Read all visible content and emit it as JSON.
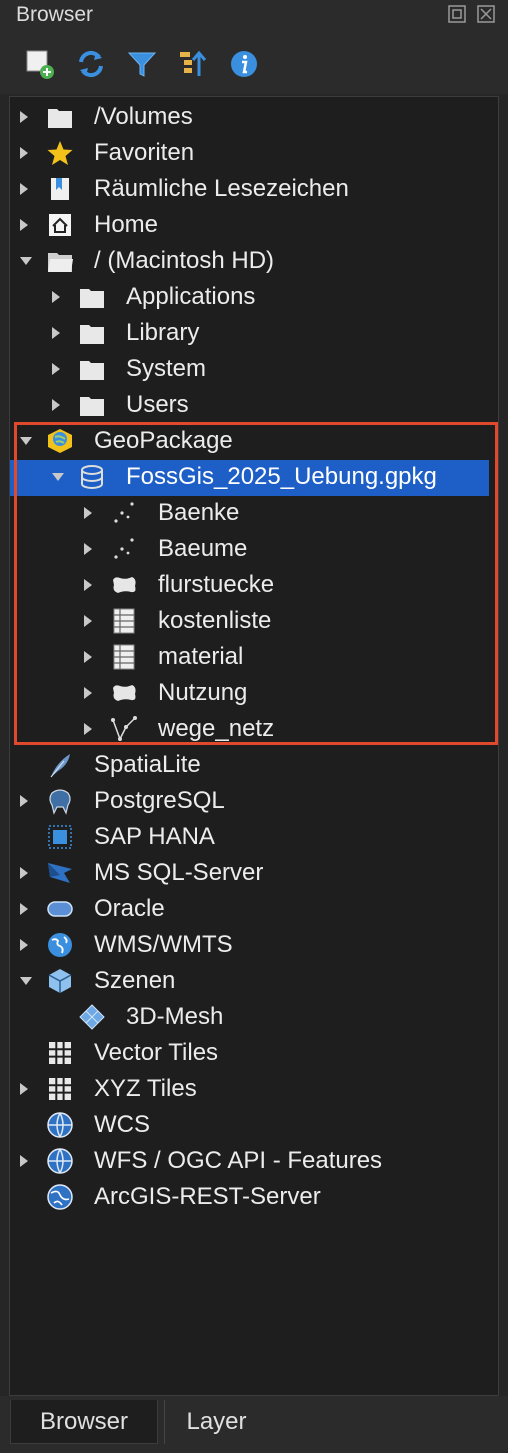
{
  "panel": {
    "title": "Browser"
  },
  "toolbar": {
    "buttons": [
      {
        "icon": "add-layer-icon"
      },
      {
        "icon": "refresh-icon"
      },
      {
        "icon": "filter-icon"
      },
      {
        "icon": "collapse-all-icon"
      },
      {
        "icon": "info-icon"
      }
    ]
  },
  "tree": {
    "items": [
      {
        "label": "/Volumes",
        "level": 0,
        "expander": "collapsed",
        "icon": "folder-icon"
      },
      {
        "label": "Favoriten",
        "level": 0,
        "expander": "collapsed",
        "icon": "star-icon"
      },
      {
        "label": "Räumliche Lesezeichen",
        "level": 0,
        "expander": "collapsed",
        "icon": "bookmark-icon"
      },
      {
        "label": "Home",
        "level": 0,
        "expander": "collapsed",
        "icon": "home-icon"
      },
      {
        "label": "/ (Macintosh HD)",
        "level": 0,
        "expander": "expanded",
        "icon": "folder-open-icon"
      },
      {
        "label": "Applications",
        "level": 1,
        "expander": "collapsed",
        "icon": "folder-icon"
      },
      {
        "label": "Library",
        "level": 1,
        "expander": "collapsed",
        "icon": "folder-icon"
      },
      {
        "label": "System",
        "level": 1,
        "expander": "collapsed",
        "icon": "folder-icon"
      },
      {
        "label": "Users",
        "level": 1,
        "expander": "collapsed",
        "icon": "folder-icon"
      },
      {
        "label": "GeoPackage",
        "level": 0,
        "expander": "expanded",
        "icon": "geopackage-icon"
      },
      {
        "label": "FossGis_2025_Uebung.gpkg",
        "level": 1,
        "expander": "expanded",
        "icon": "database-icon",
        "selected": true
      },
      {
        "label": "Baenke",
        "level": 2,
        "expander": "collapsed",
        "icon": "point-layer-icon"
      },
      {
        "label": "Baeume",
        "level": 2,
        "expander": "collapsed",
        "icon": "point-layer-icon"
      },
      {
        "label": "flurstuecke",
        "level": 2,
        "expander": "collapsed",
        "icon": "polygon-layer-icon"
      },
      {
        "label": "kostenliste",
        "level": 2,
        "expander": "collapsed",
        "icon": "table-icon"
      },
      {
        "label": "material",
        "level": 2,
        "expander": "collapsed",
        "icon": "table-icon"
      },
      {
        "label": "Nutzung",
        "level": 2,
        "expander": "collapsed",
        "icon": "polygon-layer-icon"
      },
      {
        "label": "wege_netz",
        "level": 2,
        "expander": "collapsed",
        "icon": "line-layer-icon"
      },
      {
        "label": "SpatiaLite",
        "level": 0,
        "expander": "none",
        "icon": "feather-icon"
      },
      {
        "label": "PostgreSQL",
        "level": 0,
        "expander": "collapsed",
        "icon": "elephant-icon"
      },
      {
        "label": "SAP HANA",
        "level": 0,
        "expander": "none",
        "icon": "hana-icon"
      },
      {
        "label": "MS SQL-Server",
        "level": 0,
        "expander": "collapsed",
        "icon": "mssql-icon"
      },
      {
        "label": "Oracle",
        "level": 0,
        "expander": "collapsed",
        "icon": "oracle-icon"
      },
      {
        "label": "WMS/WMTS",
        "level": 0,
        "expander": "collapsed",
        "icon": "globe-icon"
      },
      {
        "label": "Szenen",
        "level": 0,
        "expander": "expanded",
        "icon": "cube-icon"
      },
      {
        "label": "3D-Mesh",
        "level": 1,
        "expander": "none",
        "icon": "mesh-icon"
      },
      {
        "label": "Vector Tiles",
        "level": 0,
        "expander": "none",
        "icon": "grid-icon"
      },
      {
        "label": "XYZ Tiles",
        "level": 0,
        "expander": "collapsed",
        "icon": "grid-icon"
      },
      {
        "label": "WCS",
        "level": 0,
        "expander": "none",
        "icon": "wcs-globe-icon"
      },
      {
        "label": "WFS / OGC API - Features",
        "level": 0,
        "expander": "collapsed",
        "icon": "wcs-globe-icon"
      },
      {
        "label": "ArcGIS-REST-Server",
        "level": 0,
        "expander": "none",
        "icon": "arcgis-globe-icon"
      }
    ]
  },
  "tabs": [
    {
      "label": "Browser",
      "active": true
    },
    {
      "label": "Layer",
      "active": false
    }
  ],
  "colors": {
    "selection": "#1d5fc7",
    "highlight_border": "#e0492b",
    "folder": "#e8e8e8",
    "star": "#f2c21b",
    "icon_blue": "#3a8fde"
  }
}
